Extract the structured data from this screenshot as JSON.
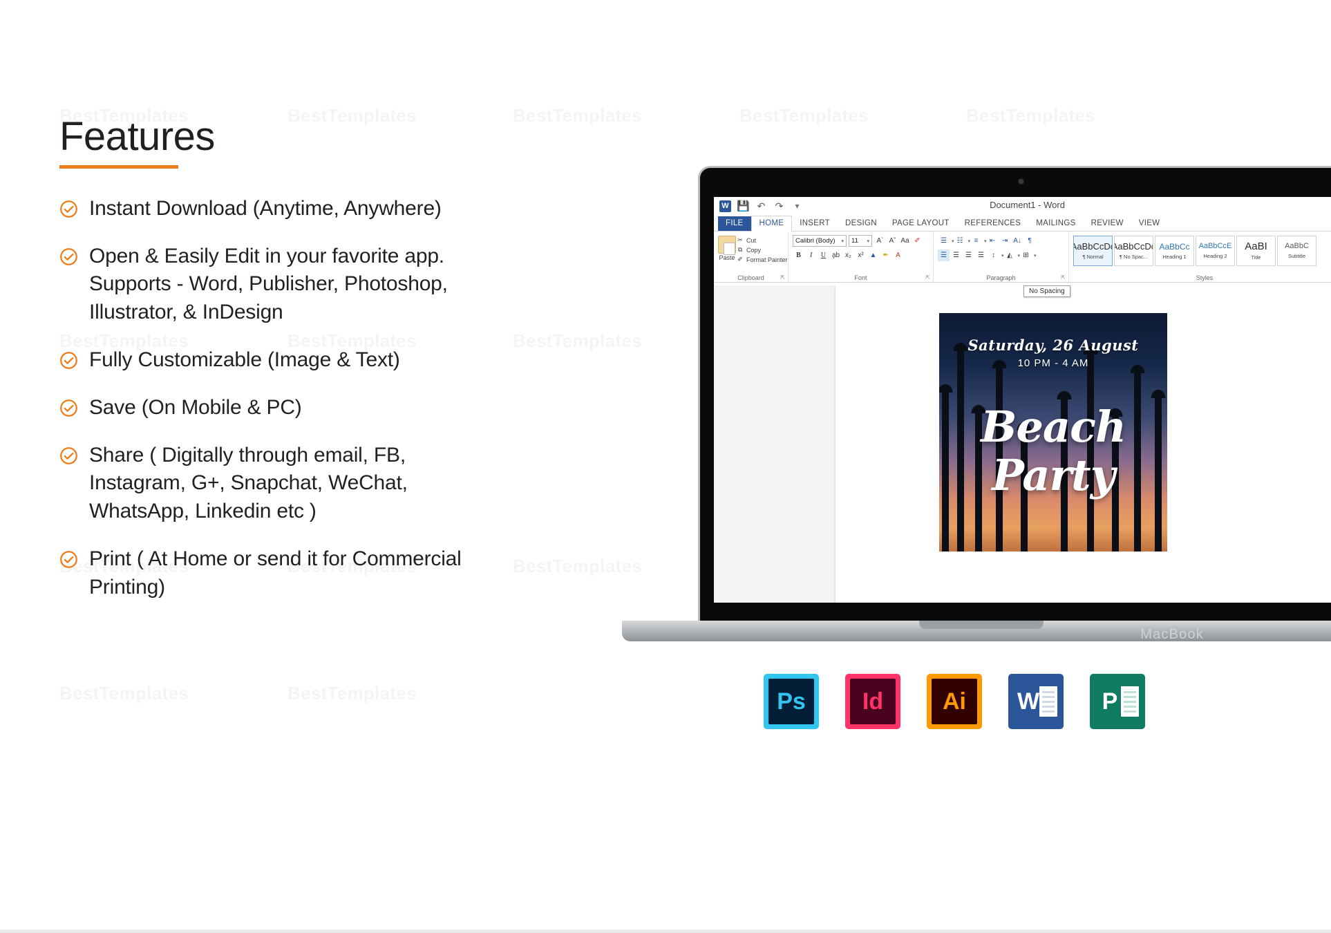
{
  "slide": {
    "watermark_text": "BestTemplates",
    "accent_color": "#ef7c1a",
    "text_color": "#231f20"
  },
  "left": {
    "title": "Features",
    "check_icon": "check-circle-icon",
    "items": [
      "Instant Download (Anytime, Anywhere)",
      "Open & Easily Edit in your favorite app. Supports - Word, Publisher, Photoshop, Illustrator, & InDesign",
      "Fully Customizable (Image & Text)",
      "Save (On Mobile & PC)",
      "Share ( Digitally through email, FB, Instagram, G+, Snapchat, WeChat, WhatsApp, Linkedin etc )",
      "Print ( At Home or send it for Commercial Printing)"
    ]
  },
  "laptop": {
    "brand_label": "MacBook",
    "camera_icon": "camera-icon"
  },
  "word": {
    "document_title": "Document1 - Word",
    "quick_access": [
      {
        "name": "word-logo-icon",
        "glyph": "W"
      },
      {
        "name": "save-icon",
        "glyph": "⬛"
      },
      {
        "name": "undo-icon",
        "glyph": "↶"
      },
      {
        "name": "redo-icon",
        "glyph": "↷"
      },
      {
        "name": "qat-more-icon",
        "glyph": "▾"
      }
    ],
    "tabs": [
      "FILE",
      "HOME",
      "INSERT",
      "DESIGN",
      "PAGE LAYOUT",
      "REFERENCES",
      "MAILINGS",
      "REVIEW",
      "VIEW"
    ],
    "active_tab": "HOME",
    "groups": {
      "clipboard": {
        "label": "Clipboard",
        "paste_label": "Paste",
        "commands": [
          {
            "icon": "cut-icon",
            "glyph": "✂",
            "label": "Cut"
          },
          {
            "icon": "copy-icon",
            "glyph": "⧉",
            "label": "Copy"
          },
          {
            "icon": "format-painter-icon",
            "glyph": "✐",
            "label": "Format Painter"
          }
        ]
      },
      "font": {
        "label": "Font",
        "font_name": "Calibri (Body)",
        "font_size": "11",
        "row1_icons": [
          {
            "name": "grow-font-icon",
            "glyph": "A˄"
          },
          {
            "name": "shrink-font-icon",
            "glyph": "Aˇ"
          },
          {
            "name": "change-case-icon",
            "glyph": "Aa"
          },
          {
            "name": "clear-formatting-icon",
            "glyph": "✐"
          }
        ],
        "row2_icons": [
          {
            "name": "bold-icon",
            "glyph": "B"
          },
          {
            "name": "italic-icon",
            "glyph": "I"
          },
          {
            "name": "underline-icon",
            "glyph": "U"
          },
          {
            "name": "strikethrough-icon",
            "glyph": "abc"
          },
          {
            "name": "subscript-icon",
            "glyph": "x₂"
          },
          {
            "name": "superscript-icon",
            "glyph": "x²"
          },
          {
            "name": "text-effects-icon",
            "glyph": "A"
          },
          {
            "name": "highlight-color-icon",
            "glyph": "✎"
          },
          {
            "name": "font-color-icon",
            "glyph": "A"
          }
        ]
      },
      "paragraph": {
        "label": "Paragraph",
        "row1_icons": [
          {
            "name": "bullets-icon",
            "glyph": "☰"
          },
          {
            "name": "numbering-icon",
            "glyph": "☷"
          },
          {
            "name": "multilevel-list-icon",
            "glyph": "≡"
          },
          {
            "name": "decrease-indent-icon",
            "glyph": "⇤"
          },
          {
            "name": "increase-indent-icon",
            "glyph": "⇥"
          },
          {
            "name": "sort-icon",
            "glyph": "A↓"
          },
          {
            "name": "show-marks-icon",
            "glyph": "¶"
          }
        ],
        "row2_icons": [
          {
            "name": "align-left-icon",
            "glyph": "≡"
          },
          {
            "name": "align-center-icon",
            "glyph": "≡"
          },
          {
            "name": "align-right-icon",
            "glyph": "≡"
          },
          {
            "name": "justify-icon",
            "glyph": "≡"
          },
          {
            "name": "line-spacing-icon",
            "glyph": "↕"
          },
          {
            "name": "shading-icon",
            "glyph": "◭"
          },
          {
            "name": "borders-icon",
            "glyph": "⊞"
          }
        ]
      },
      "styles": {
        "label": "Styles",
        "items": [
          {
            "sample": "AaBbCcDc",
            "name": "¶ Normal",
            "kind": "body",
            "selected": false
          },
          {
            "sample": "AaBbCcDc",
            "name": "¶ No Spac...",
            "kind": "body",
            "selected": false
          },
          {
            "sample": "AaBbCс",
            "name": "Heading 1",
            "kind": "h1",
            "selected": false
          },
          {
            "sample": "AaBbCcE",
            "name": "Heading 2",
            "kind": "h2",
            "selected": false
          },
          {
            "sample": "AaBІ",
            "name": "Title",
            "kind": "title",
            "selected": false
          },
          {
            "sample": "AaBbC",
            "name": "Subtitle",
            "kind": "subtitle",
            "selected": false
          }
        ]
      }
    },
    "tooltip": "No Spacing"
  },
  "poster": {
    "date": "Saturday, 26 August",
    "time": "10 PM - 4 AM",
    "headline_line1": "Beach",
    "headline_line2": "Party"
  },
  "app_icons": [
    {
      "id": "icon-ps",
      "glyph": "Ps",
      "name": "photoshop-icon"
    },
    {
      "id": "icon-id",
      "glyph": "Id",
      "name": "indesign-icon"
    },
    {
      "id": "icon-ai",
      "glyph": "Ai",
      "name": "illustrator-icon"
    },
    {
      "id": "icon-wd",
      "glyph": "W",
      "name": "word-icon"
    },
    {
      "id": "icon-pb",
      "glyph": "P",
      "name": "publisher-icon"
    }
  ]
}
